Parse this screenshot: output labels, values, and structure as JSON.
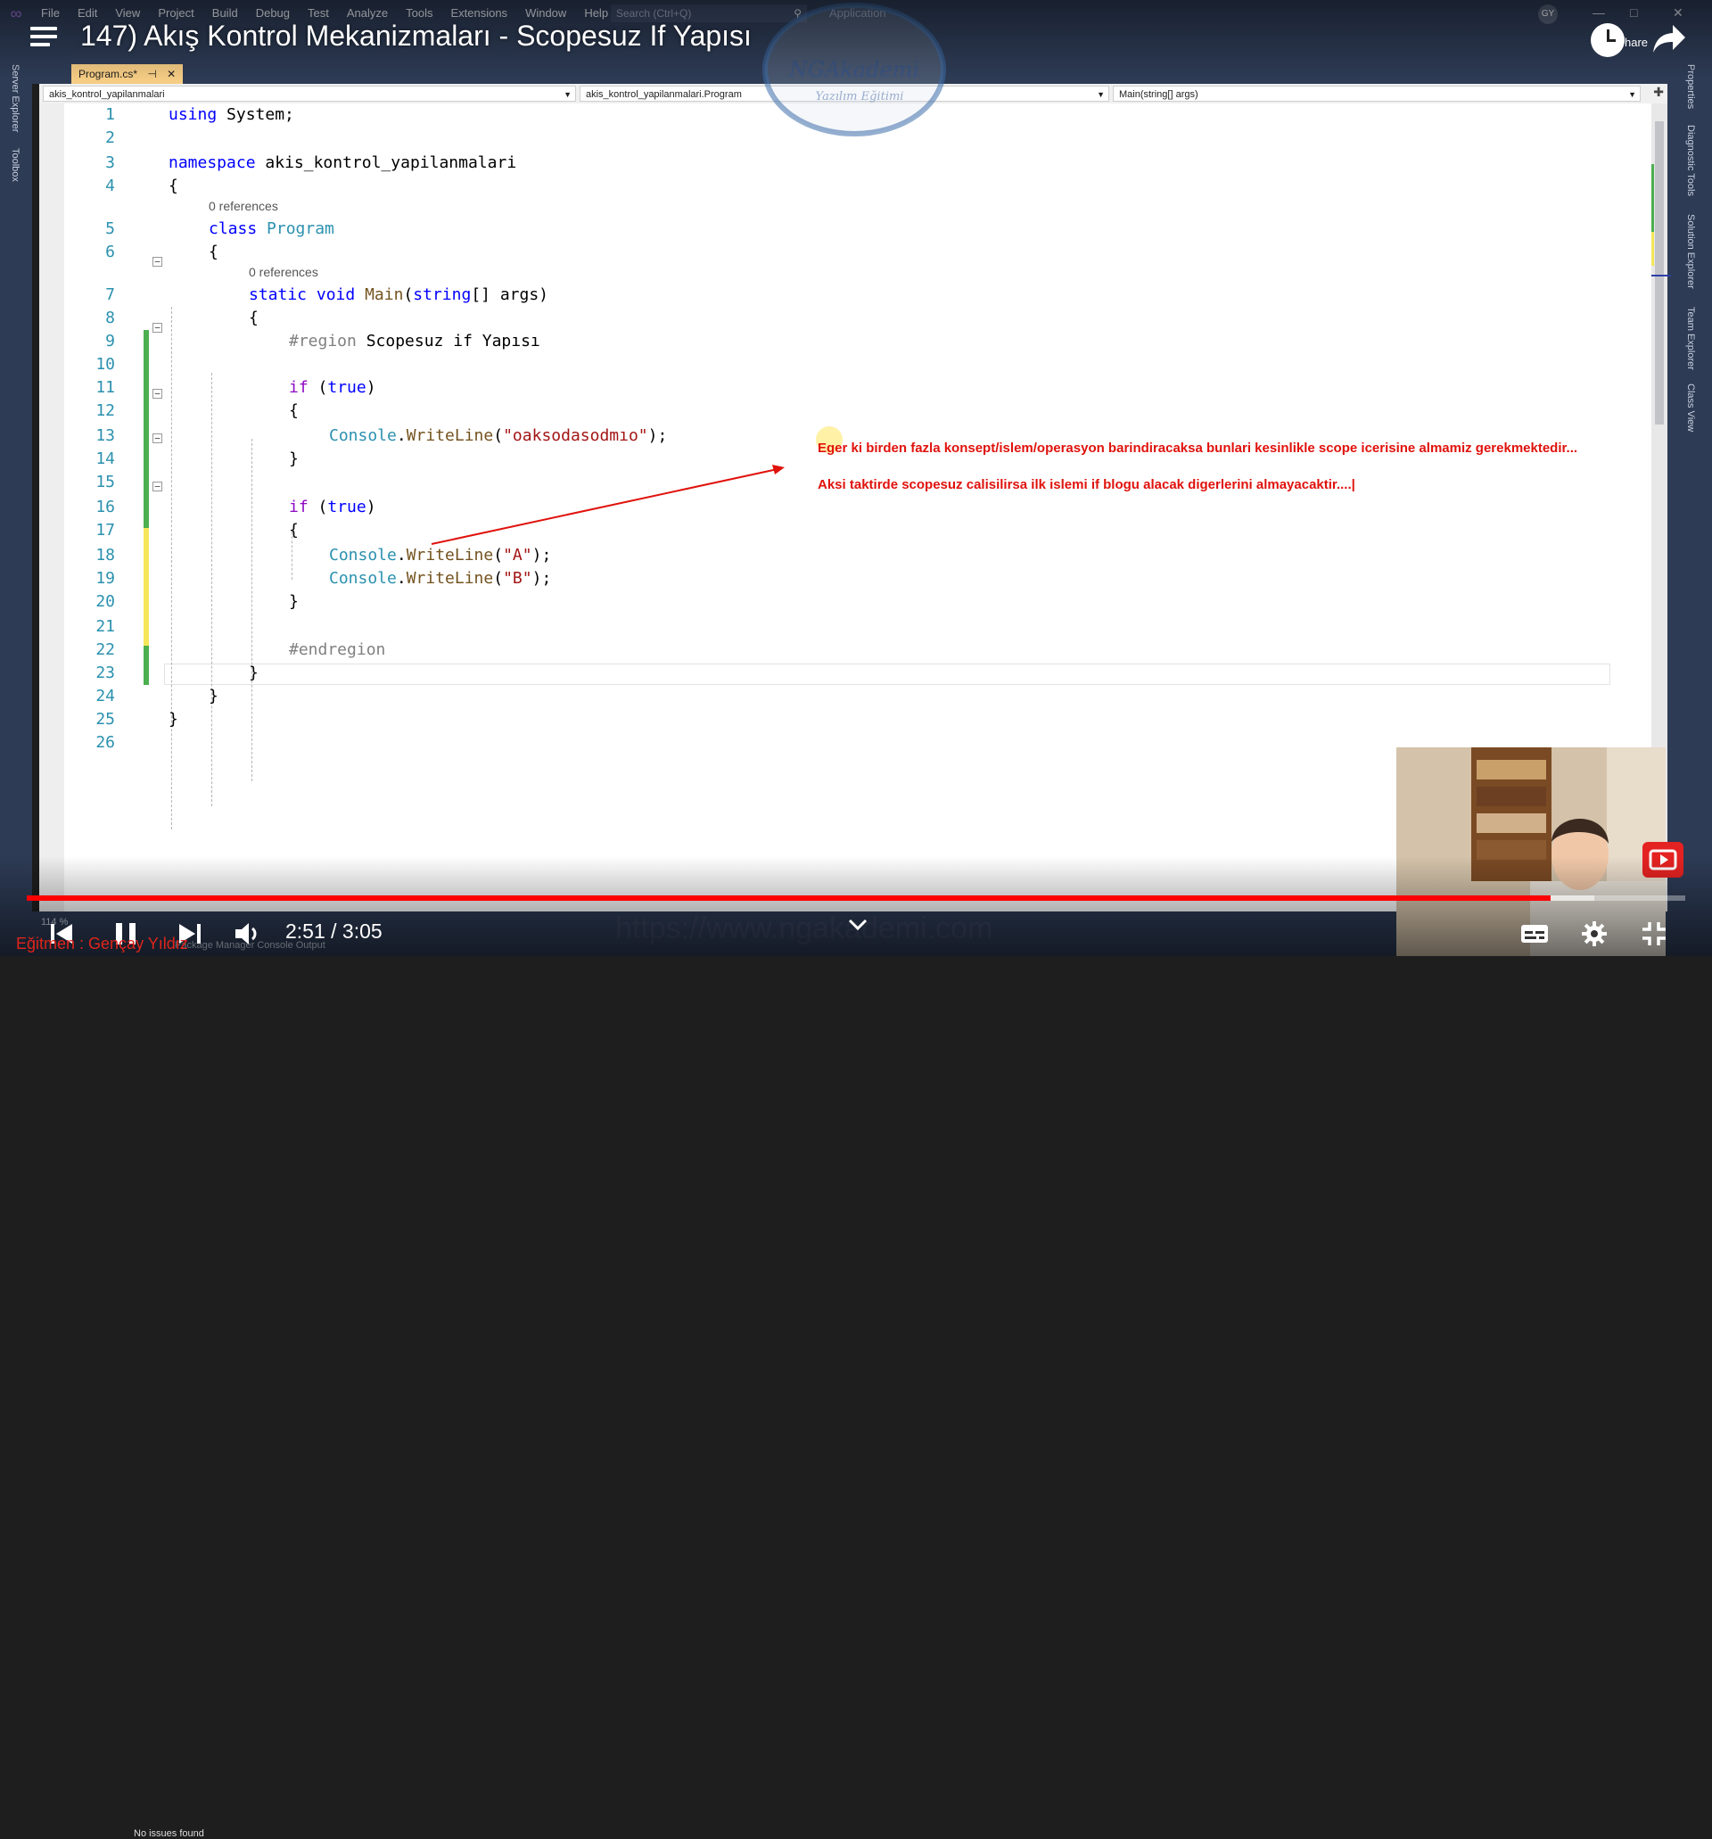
{
  "vs": {
    "menu": [
      "File",
      "Edit",
      "View",
      "Project",
      "Build",
      "Debug",
      "Test",
      "Analyze",
      "Tools",
      "Extensions",
      "Window",
      "Help"
    ],
    "search_placeholder": "Search (Ctrl+Q)",
    "app_name": "Application",
    "user_initials": "GY",
    "share_label": "hare",
    "left_rail": [
      "Server Explorer",
      "Toolbox"
    ],
    "right_rail": [
      "Properties",
      "Diagnostic Tools",
      "Solution Explorer",
      "Team Explorer",
      "Class View"
    ],
    "doc_tab": "Program.cs*",
    "nav": {
      "project": "akis_kontrol_yapilanmalari",
      "class": "akis_kontrol_yapilanmalari.Program",
      "member": "Main(string[] args)"
    },
    "code": {
      "references_label": "0 references",
      "namespace": "akis_kontrol_yapilanmalari",
      "class_name": "Program",
      "region_name": "Scopesuz if Yapısı",
      "string1": "\"oaksodasodmıo\"",
      "stringA": "\"A\"",
      "stringB": "\"B\""
    },
    "status": {
      "zoom": "114 %",
      "issues": "No issues found",
      "tabs": "Package Manager Console   Output"
    }
  },
  "annotation": {
    "line1": "Eger ki birden fazla konsept/islem/operasyon barindiracaksa bunlari kesinlikle scope icerisine almamiz gerekmektedir...",
    "line2": "Aksi taktirde scopesuz calisilirsa ilk islemi if blogu alacak digerlerini almayacaktir....|"
  },
  "watermark": {
    "logo_text": "NGAkademi",
    "logo_sub": "Yazılım Eğitimi",
    "url": "https://www.ngakademi.com"
  },
  "youtube": {
    "title": "147) Akış Kontrol Mekanizmaları - Scopesuz If Yapısı",
    "time": "2:51 / 3:05",
    "progress_played": 0.919,
    "progress_buffered": 0.945,
    "instructor": "Eğitmen : Gençay Yıldız"
  }
}
